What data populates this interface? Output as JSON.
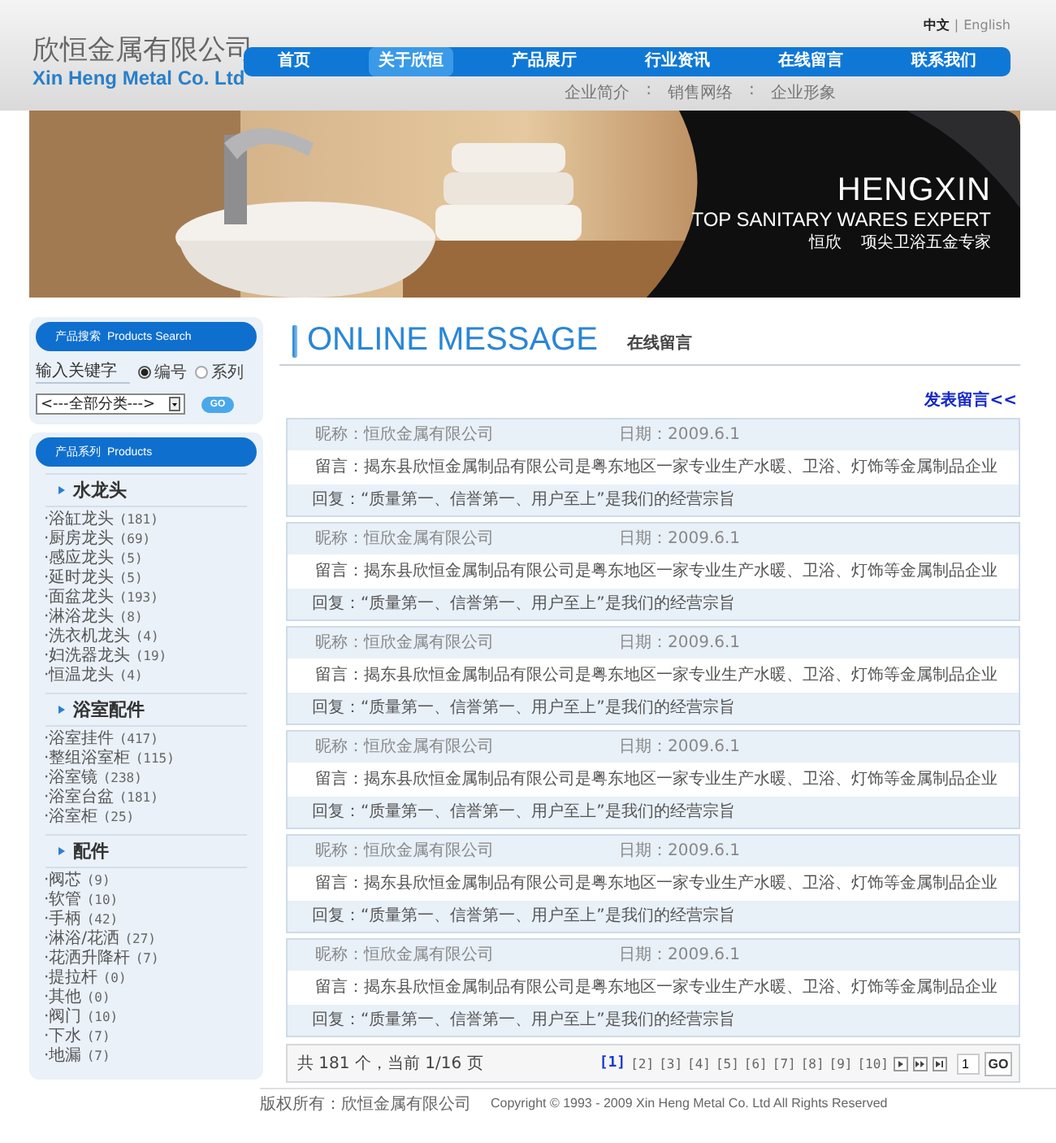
{
  "header": {
    "company_name": "欣恒金属有限公司",
    "company_name_en": "Xin Heng Metal Co. Ltd",
    "languages": [
      {
        "label": "中文",
        "selected": true
      },
      {
        "label": "English",
        "selected": false
      }
    ],
    "language_separator": "|",
    "nav": [
      {
        "label": "首页",
        "selected": false
      },
      {
        "label": "关于欣恒",
        "selected": true
      },
      {
        "label": "产品展厅",
        "selected": false
      },
      {
        "label": "行业资讯",
        "selected": false
      },
      {
        "label": "在线留言",
        "selected": false
      },
      {
        "label": "联系我们",
        "selected": false
      }
    ],
    "subnav": {
      "items": [
        "企业简介",
        "销售网络",
        "企业形象"
      ],
      "separator": ":"
    }
  },
  "banner": {
    "kind": "picture",
    "title": "HENGXIN",
    "subtitle": "TOP SANITARY WARES EXPERT",
    "brand": "恒欣",
    "slogan": "项尖卫浴五金专家"
  },
  "search": {
    "title": "产品搜索",
    "title_en": "Products Search",
    "placeholder": "输入关键字",
    "options": [
      {
        "label": "编号",
        "selected": true
      },
      {
        "label": "系列",
        "selected": false
      }
    ],
    "category": "<---全部分类--->",
    "button": "GO"
  },
  "products": {
    "title": "产品系列",
    "title_en": "Products",
    "groups": [
      {
        "name": "水龙头",
        "items": [
          {
            "label": "·浴缸龙头",
            "count": "(181)"
          },
          {
            "label": "·厨房龙头",
            "count": "(69)"
          },
          {
            "label": "·感应龙头",
            "count": "(5)"
          },
          {
            "label": "·延时龙头",
            "count": "(5)"
          },
          {
            "label": "·面盆龙头",
            "count": "(193)"
          },
          {
            "label": "·淋浴龙头",
            "count": "(8)"
          },
          {
            "label": "·洗衣机龙头",
            "count": "(4)"
          },
          {
            "label": "·妇洗器龙头",
            "count": "(19)"
          },
          {
            "label": "·恒温龙头",
            "count": "(4)"
          }
        ]
      },
      {
        "name": "浴室配件",
        "items": [
          {
            "label": "·浴室挂件",
            "count": "(417)"
          },
          {
            "label": "·整组浴室柜",
            "count": "(115)"
          },
          {
            "label": "·浴室镜",
            "count": "(238)"
          },
          {
            "label": "·浴室台盆",
            "count": "(181)"
          },
          {
            "label": "·浴室柜",
            "count": "(25)"
          }
        ]
      },
      {
        "name": "配件",
        "items": [
          {
            "label": "·阀芯",
            "count": "(9)"
          },
          {
            "label": "·软管",
            "count": "(10)"
          },
          {
            "label": "·手柄",
            "count": "(42)"
          },
          {
            "label": "·淋浴/花洒",
            "count": "(27)"
          },
          {
            "label": "·花洒升降杆",
            "count": "(7)"
          },
          {
            "label": "·提拉杆",
            "count": "(0)"
          },
          {
            "label": "·其他",
            "count": "(0)"
          },
          {
            "label": "·阀门",
            "count": "(10)"
          },
          {
            "label": "·下水",
            "count": "(7)"
          },
          {
            "label": "·地漏",
            "count": "(7)"
          }
        ]
      }
    ]
  },
  "section": {
    "title": "ONLINE MESSAGE",
    "title_cn": "在线留言",
    "post_link": "发表留言<<"
  },
  "messages": [
    {
      "nickname": "昵称：恒欣金属有限公司",
      "date": "日期：2009.6.1",
      "message": "留言：揭东县欣恒金属制品有限公司是粤东地区一家专业生产水暖、卫浴、灯饰等金属制品企业",
      "reply": "回复：“质量第一、信誉第一、用户至上”是我们的经营宗旨"
    },
    {
      "nickname": "昵称：恒欣金属有限公司",
      "date": "日期：2009.6.1",
      "message": "留言：揭东县欣恒金属制品有限公司是粤东地区一家专业生产水暖、卫浴、灯饰等金属制品企业",
      "reply": "回复：“质量第一、信誉第一、用户至上”是我们的经营宗旨"
    },
    {
      "nickname": "昵称：恒欣金属有限公司",
      "date": "日期：2009.6.1",
      "message": "留言：揭东县欣恒金属制品有限公司是粤东地区一家专业生产水暖、卫浴、灯饰等金属制品企业",
      "reply": "回复：“质量第一、信誉第一、用户至上”是我们的经营宗旨"
    },
    {
      "nickname": "昵称：恒欣金属有限公司",
      "date": "日期：2009.6.1",
      "message": "留言：揭东县欣恒金属制品有限公司是粤东地区一家专业生产水暖、卫浴、灯饰等金属制品企业",
      "reply": "回复：“质量第一、信誉第一、用户至上”是我们的经营宗旨"
    },
    {
      "nickname": "昵称：恒欣金属有限公司",
      "date": "日期：2009.6.1",
      "message": "留言：揭东县欣恒金属制品有限公司是粤东地区一家专业生产水暖、卫浴、灯饰等金属制品企业",
      "reply": "回复：“质量第一、信誉第一、用户至上”是我们的经营宗旨"
    },
    {
      "nickname": "昵称：恒欣金属有限公司",
      "date": "日期：2009.6.1",
      "message": "留言：揭东县欣恒金属制品有限公司是粤东地区一家专业生产水暖、卫浴、灯饰等金属制品企业",
      "reply": "回复：“质量第一、信誉第一、用户至上”是我们的经营宗旨"
    }
  ],
  "pagination": {
    "summary": "共 181 个，当前 1/16 页",
    "pages": [
      {
        "label": "[1]",
        "selected": true
      },
      {
        "label": "[2]",
        "selected": false
      },
      {
        "label": "[3]",
        "selected": false
      },
      {
        "label": "[4]",
        "selected": false
      },
      {
        "label": "[5]",
        "selected": false
      },
      {
        "label": "[6]",
        "selected": false
      },
      {
        "label": "[7]",
        "selected": false
      },
      {
        "label": "[8]",
        "selected": false
      },
      {
        "label": "[9]",
        "selected": false
      },
      {
        "label": "[10]",
        "selected": false
      }
    ],
    "page_value": "1",
    "button": "GO"
  },
  "footer": {
    "owner": "版权所有：欣恒金属有限公司",
    "copyright": "Copyright © 1993 - 2009 Xin Heng Metal Co. Ltd All Rights Reserved"
  }
}
